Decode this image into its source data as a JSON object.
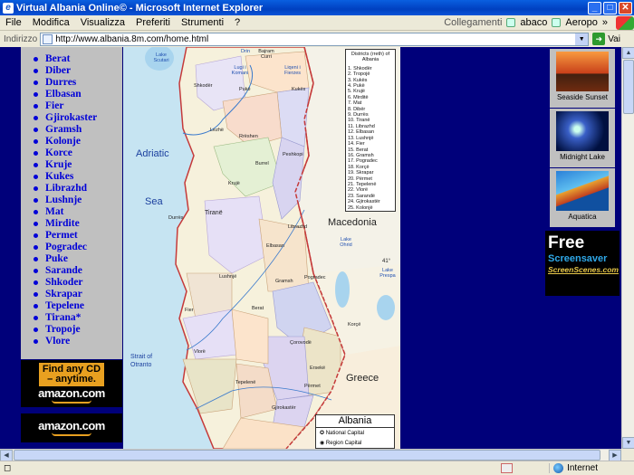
{
  "window": {
    "title": "Virtual Albania Online© - Microsoft Internet Explorer",
    "minimize": "_",
    "maximize": "□",
    "close": "✕"
  },
  "menu": {
    "items": [
      "File",
      "Modifica",
      "Visualizza",
      "Preferiti",
      "Strumenti",
      "?"
    ],
    "links_label": "Collegamenti",
    "links": [
      "abaco",
      "Aeropo"
    ],
    "chevron": "»"
  },
  "address": {
    "label": "Indirizzo",
    "url": "http://www.albania.8m.com/home.html",
    "go_label": "Vai"
  },
  "nav": {
    "items": [
      "Berat",
      "Diber",
      "Durres",
      "Elbasan",
      "Fier",
      "Gjirokaster",
      "Gramsh",
      "Kolonje",
      "Korce",
      "Kruje",
      "Kukes",
      "Librazhd",
      "Lushnje",
      "Mat",
      "Mirdite",
      "Permet",
      "Pogradec",
      "Puke",
      "Sarande",
      "Shkoder",
      "Skrapar",
      "Tepelene",
      "Tirana*",
      "Tropoje",
      "Vlore"
    ]
  },
  "amazon": {
    "banner_line1": "Find any CD",
    "banner_line2": "– anytime.",
    "logo": "amazon.com",
    "logo2": "amazon.com"
  },
  "map": {
    "seas": [
      "Adriatic",
      "Sea",
      "Strait of Otranto"
    ],
    "countries": [
      "Macedonia",
      "Greece"
    ],
    "legend_title": "Districts (rreth) of Albania",
    "districts": [
      "1. Shkodër",
      "2. Tropojë",
      "3. Kukës",
      "4. Pukë",
      "5. Krujë",
      "6. Mirditë",
      "7. Mat",
      "8. Dibër",
      "9. Durrës",
      "10. Tiranë",
      "11. Librazhd",
      "12. Elbasan",
      "13. Lushnjë",
      "14. Fier",
      "15. Berat",
      "16. Gramsh",
      "17. Pogradec",
      "18. Korçë",
      "19. Skrapar",
      "20. Përmet",
      "21. Tepelenë",
      "22. Vlorë",
      "23. Sarandë",
      "24. Gjirokastër",
      "25. Kolonjë"
    ],
    "key_title": "Albania",
    "key_items": [
      "National Capital",
      "Region Capital"
    ],
    "towns": [
      "Bajram Curri",
      "Shkodër",
      "Pukë",
      "Kukës",
      "Lezhë",
      "Rrëshen",
      "Burrel",
      "Peshkopi",
      "Krujë",
      "Tiranë",
      "Durrës",
      "Librazhd",
      "Elbasan",
      "Lushnjë",
      "Gramsh",
      "Pogradec",
      "Fier",
      "Berat",
      "Korçë",
      "Vlorë",
      "Çorovodë",
      "Ersekë",
      "Tepelenë",
      "Përmet",
      "Gjirokastër"
    ],
    "waters": [
      "Lake Scutari",
      "Lake Ohrid",
      "Lake Prespa",
      "Drin",
      "Lugi i Komani",
      "Liqeni i Fierzes"
    ],
    "coord": "41°"
  },
  "screensavers": {
    "items": [
      "Seaside Sunset",
      "Midnight Lake",
      "Aquatica"
    ],
    "free_line1": "Free",
    "free_line2": "Screensaver",
    "free_line3": "ScreenScenes.com"
  },
  "status": {
    "zone": "Internet"
  }
}
